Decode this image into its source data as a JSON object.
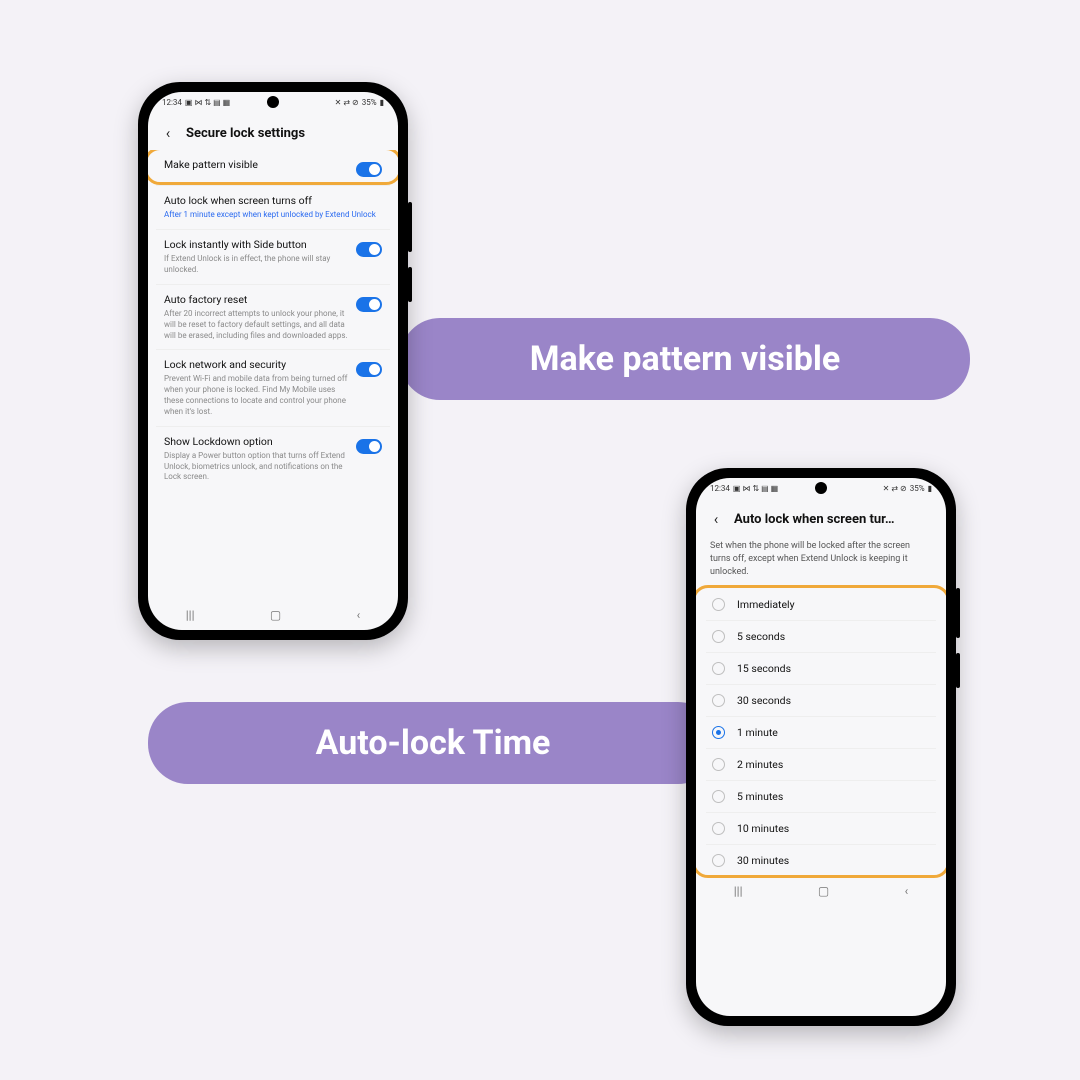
{
  "callouts": {
    "first": "Make pattern visible",
    "second": "Auto-lock Time"
  },
  "status": {
    "time": "12:34",
    "left_icons": "▣ ⋈ ⇅ ▤ ▦",
    "right_icons": "✕ ⇄ ⊘",
    "battery": "35%"
  },
  "phone1": {
    "title": "Secure lock settings",
    "rows": [
      {
        "name": "Make pattern visible",
        "desc": "",
        "toggle": true
      },
      {
        "name": "Auto lock when screen turns off",
        "desc": "After 1 minute except when kept unlocked by Extend Unlock",
        "toggle": false,
        "blue": true
      },
      {
        "name": "Lock instantly with Side button",
        "desc": "If Extend Unlock is in effect, the phone will stay unlocked.",
        "toggle": true
      },
      {
        "name": "Auto factory reset",
        "desc": "After 20 incorrect attempts to unlock your phone, it will be reset to factory default settings, and all data will be erased, including files and downloaded apps.",
        "toggle": true
      },
      {
        "name": "Lock network and security",
        "desc": "Prevent Wi-Fi and mobile data from being turned off when your phone is locked. Find My Mobile uses these connections to locate and control your phone when it's lost.",
        "toggle": true
      },
      {
        "name": "Show Lockdown option",
        "desc": "Display a Power button option that turns off Extend Unlock, biometrics unlock, and notifications on the Lock screen.",
        "toggle": true
      }
    ]
  },
  "phone2": {
    "title": "Auto lock when screen tur…",
    "intro": "Set when the phone will be locked after the screen turns off, except when Extend Unlock is keeping it unlocked.",
    "options": [
      {
        "label": "Immediately",
        "selected": false
      },
      {
        "label": "5 seconds",
        "selected": false
      },
      {
        "label": "15 seconds",
        "selected": false
      },
      {
        "label": "30 seconds",
        "selected": false
      },
      {
        "label": "1 minute",
        "selected": true
      },
      {
        "label": "2 minutes",
        "selected": false
      },
      {
        "label": "5 minutes",
        "selected": false
      },
      {
        "label": "10 minutes",
        "selected": false
      },
      {
        "label": "30 minutes",
        "selected": false
      }
    ]
  }
}
